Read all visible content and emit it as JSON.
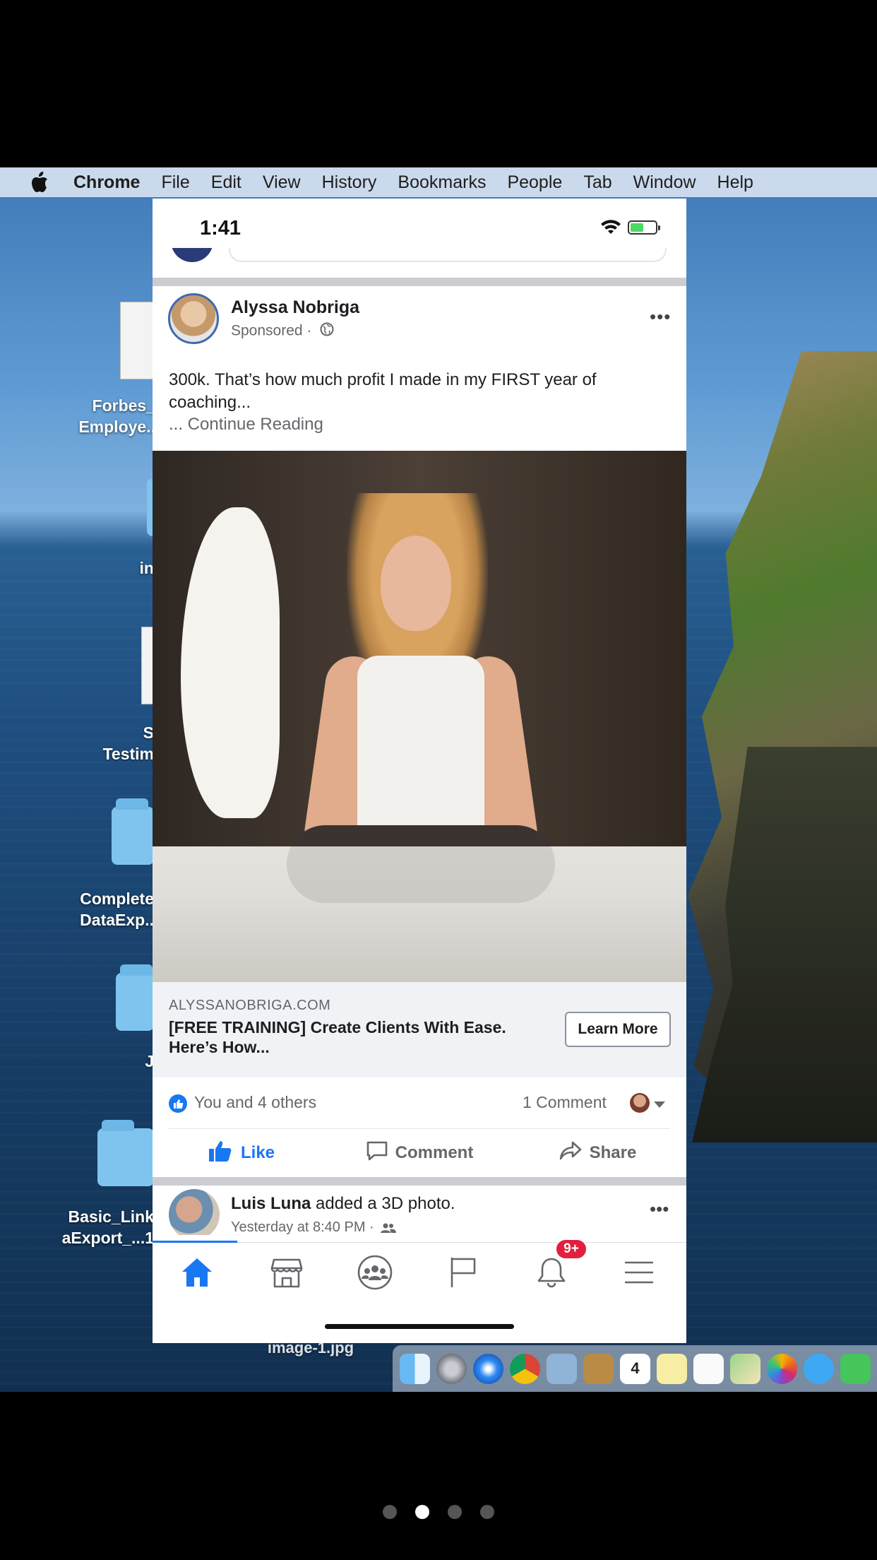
{
  "menubar": {
    "items": [
      "Chrome",
      "File",
      "Edit",
      "View",
      "History",
      "Bookmarks",
      "People",
      "Tab",
      "Window",
      "Help"
    ]
  },
  "desktop": {
    "icons": [
      {
        "label": "Forbes_\nEmploye..",
        "type": "xl-document"
      },
      {
        "label": "in",
        "type": "folder"
      },
      {
        "label": "S\nTestim",
        "type": "document"
      },
      {
        "label": "Complete\nDataExp..",
        "type": "folder"
      },
      {
        "label": "J",
        "type": "folder"
      },
      {
        "label": "Basic_Link\naExport_...1",
        "type": "folder"
      },
      {
        "label": "image-1.jpg",
        "type": "image"
      }
    ],
    "dock_apps": [
      "finder",
      "launchpad",
      "safari",
      "chrome",
      "preview",
      "notes-book",
      "calendar",
      "stickies",
      "reminders",
      "maps",
      "photos",
      "messages",
      "facetime"
    ],
    "calendar_day": "4"
  },
  "phone": {
    "status": {
      "time": "1:41",
      "wifi_icon": "wifi-icon",
      "battery_icon": "battery-charging-icon"
    },
    "post": {
      "author": "Alyssa Nobriga",
      "sponsored": "Sponsored ·",
      "text": "300k. That’s how much profit I made in my FIRST year of coaching...",
      "continue_prefix": "... ",
      "continue_label": "Continue Reading",
      "link_domain": "ALYSSANOBRIGA.COM",
      "link_title": "[FREE TRAINING] Create Clients With Ease. Here’s How...",
      "cta": "Learn More",
      "reactors": "You and 4 others",
      "comments": "1 Comment",
      "actions": {
        "like": "Like",
        "comment": "Comment",
        "share": "Share"
      }
    },
    "next_post": {
      "author": "Luis Luna",
      "action": " added a 3D photo.",
      "time": "Yesterday at 8:40 PM ·"
    },
    "tabbar": {
      "tabs": [
        "home-icon",
        "marketplace-icon",
        "groups-icon",
        "pages-flag-icon",
        "notifications-bell-icon",
        "menu-icon"
      ],
      "notification_badge": "9+"
    }
  },
  "pager": {
    "count": 4,
    "active_index": 1
  },
  "colors": {
    "fb_blue": "#1877f2",
    "badge_red": "#e41e3f",
    "menubar": "#d6e2f0"
  }
}
